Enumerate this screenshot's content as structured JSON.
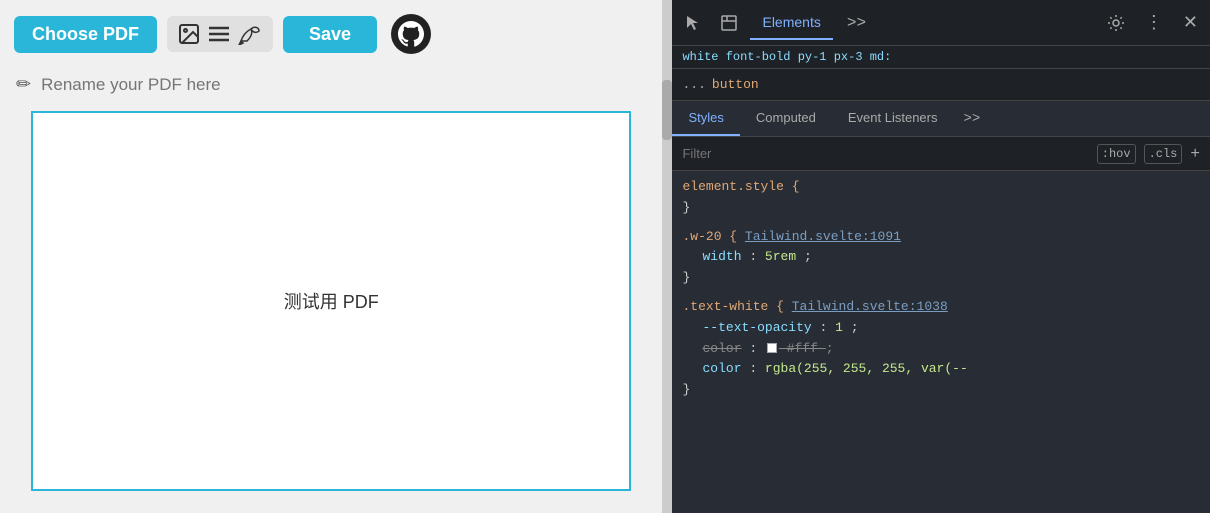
{
  "toolbar": {
    "choose_pdf_label": "Choose PDF",
    "save_label": "Save",
    "icon_image": "🖼",
    "icon_list": "≡",
    "icon_pen": "𝓌"
  },
  "rename": {
    "placeholder": "Rename your PDF here",
    "pencil": "✏"
  },
  "pdf": {
    "content_text": "测试用 PDF"
  },
  "devtools": {
    "tabs": [
      "Elements",
      ">>"
    ],
    "active_tab": "Elements",
    "breadcrumb_dots": "...",
    "breadcrumb_tag": "button",
    "top_css": "white font-bold py-1 px-3 md:",
    "style_tabs": [
      "Styles",
      "Computed",
      "Event Listeners",
      ">>"
    ],
    "active_style_tab": "Styles",
    "filter_placeholder": "Filter",
    "filter_hov": ":hov",
    "filter_cls": ".cls",
    "rules": [
      {
        "selector": "element.style {",
        "close": "}",
        "source": "",
        "props": []
      },
      {
        "selector": ".w-20 {",
        "close": "}",
        "source": "Tailwind.svelte:1091",
        "props": [
          {
            "name": "width",
            "value": "5rem",
            "strikethrough": false
          }
        ]
      },
      {
        "selector": ".text-white {",
        "close": "}",
        "source": "Tailwind.svelte:1038",
        "props": [
          {
            "name": "--text-opacity",
            "value": "1",
            "strikethrough": false
          },
          {
            "name": "color",
            "value": "#fff",
            "strikethrough": true,
            "has_swatch": true
          },
          {
            "name": "color",
            "value": "rgba(255, 255, 255, var(--",
            "strikethrough": false
          }
        ]
      }
    ]
  },
  "colors": {
    "accent": "#29b6d8",
    "devtools_bg": "#282c34",
    "devtools_topbar": "#1e2126"
  }
}
